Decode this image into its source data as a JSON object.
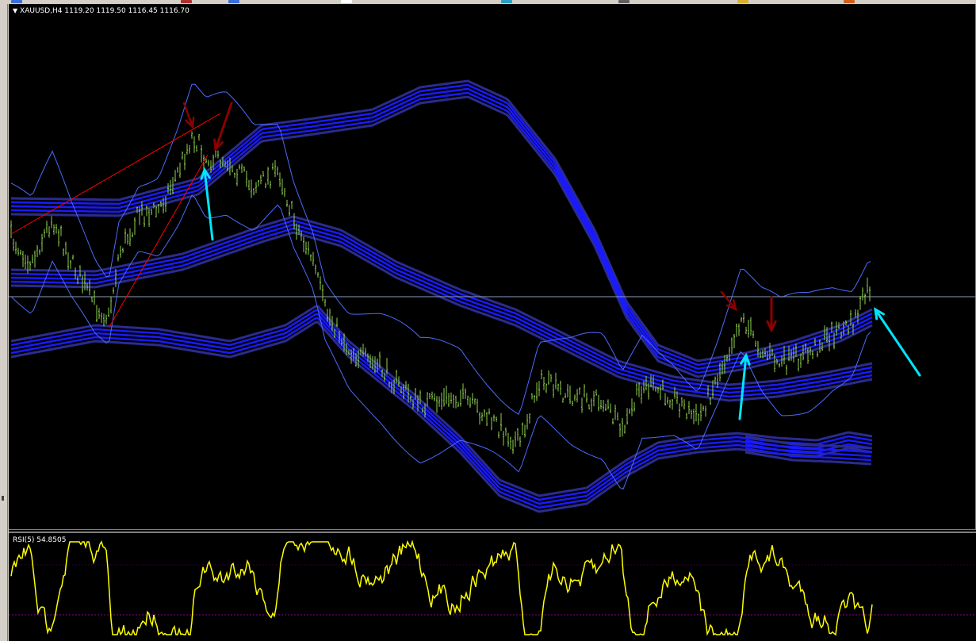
{
  "window": {
    "symbol_label": "XAUUSD,H4",
    "ohlc_label": "1119.20 1119.50 1116.45 1116.70",
    "collapse_icon": "triangle-down-icon"
  },
  "rsi": {
    "label": "RSI(5) 54.8505"
  },
  "toolbar_icons": [
    "toolbar-icon-blue",
    "toolbar-icon-red",
    "toolbar-icon-white",
    "toolbar-icon-teal",
    "toolbar-icon-grey",
    "toolbar-icon-yellow",
    "toolbar-icon-orange"
  ],
  "colors": {
    "background": "#000000",
    "candles": "#8fd14f",
    "envelope_bands": "#1a1aff",
    "envelope_outer": "#2b2b8f",
    "bollinger": "#4a6bff",
    "rsi_line": "#ffff00",
    "trendline": "#ff0000",
    "signal_arrow_up": "#00e5ff",
    "signal_arrow_down": "#8b0000",
    "horizontal_line": "#8a9bb8",
    "rsi_level": "#8b008b"
  },
  "chart_data": {
    "type": "line",
    "title": "XAUUSD,H4 1119.20 1119.50 1116.45 1116.70",
    "symbol": "XAUUSD",
    "timeframe": "H4",
    "last_bar": {
      "open": 1119.2,
      "high": 1119.5,
      "low": 1116.45,
      "close": 1116.7
    },
    "grid": false,
    "indicator": {
      "name": "RSI(5)",
      "value": 54.8505
    }
  }
}
